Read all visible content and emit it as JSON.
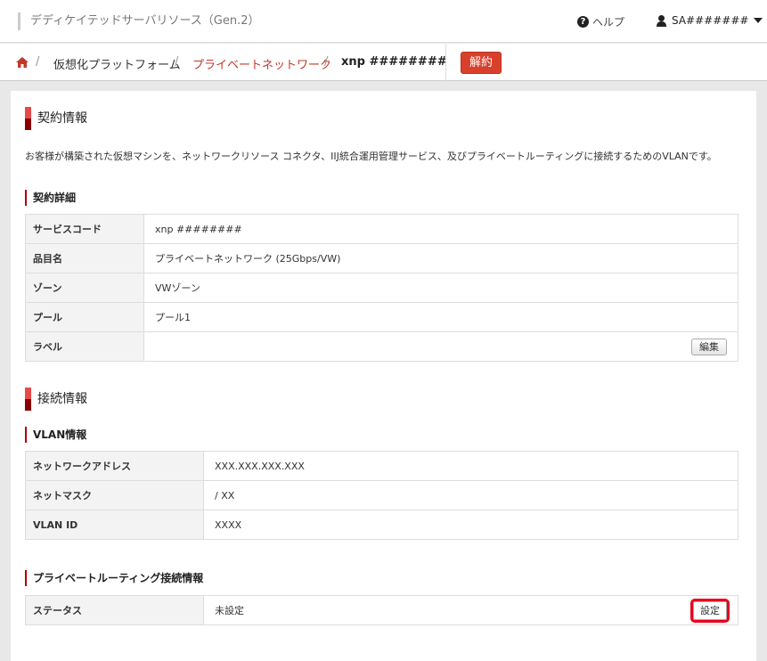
{
  "header": {
    "app_name": "デディケイテッドサーバリソース（Gen.2）",
    "help_label": "ヘルプ",
    "user_name": "SA#######"
  },
  "breadcrumb": {
    "items": [
      "仮想化プラットフォーム",
      "プライベートネットワーク",
      "xnp ########"
    ],
    "cancel_label": "解約"
  },
  "contract": {
    "title": "契約情報",
    "description": "お客様が構築された仮想マシンを、ネットワークリソース コネクタ、IIJ統合運用管理サービス、及びプライベートルーティングに接続するためのVLANです。",
    "details_title": "契約詳細",
    "rows": [
      {
        "label": "サービスコード",
        "value": "xnp ########"
      },
      {
        "label": "品目名",
        "value": "プライベートネットワーク (25Gbps/VW)"
      },
      {
        "label": "ゾーン",
        "value": "VWゾーン"
      },
      {
        "label": "プール",
        "value": "プール1"
      },
      {
        "label": "ラベル",
        "value": ""
      }
    ],
    "edit_label": "編集"
  },
  "connection": {
    "title": "接続情報",
    "vlan_title": "VLAN情報",
    "vlan_rows": [
      {
        "label": "ネットワークアドレス",
        "value": "XXX.XXX.XXX.XXX"
      },
      {
        "label": "ネットマスク",
        "value": "/ XX"
      },
      {
        "label": "VLAN ID",
        "value": "XXXX"
      }
    ],
    "routing_title": "プライベートルーティング接続情報",
    "routing_rows": [
      {
        "label": "ステータス",
        "value": "未設定"
      }
    ],
    "setting_label": "設定"
  },
  "colors": {
    "accent": "#d9402b",
    "highlight": "#e8001c"
  }
}
